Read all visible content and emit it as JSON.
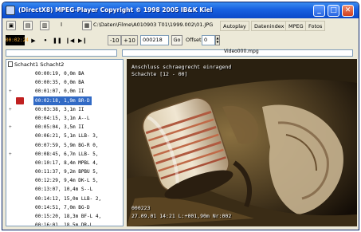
{
  "window": {
    "title": "(DirectX8)  MPEG-Player  Copyright © 1998 2005 IB&K  Kiel"
  },
  "toolbar": {
    "file_path": "C:\\Daten\\Filme\\A010903 T01\\1999.002\\01.JPG",
    "autoplay_label": "Autoplay",
    "dateindex_label": "Datenindex",
    "mpeg_label": "MPEG",
    "fotos_label": "Fotos"
  },
  "transport": {
    "timecode": "00:02:24",
    "back10_label": "-10",
    "fwd10_label": "+10",
    "frame_value": "000218",
    "go_label": "Go",
    "offset_label": "Offset",
    "offset_value": "0"
  },
  "video_file": "Video000.mpg",
  "tree": {
    "header": "Schacht1  Schacht2",
    "rows": [
      {
        "time": "00:00:19",
        "text": "0,0m BA",
        "expand": "",
        "selected": false,
        "marker": false
      },
      {
        "time": "00:00:35",
        "text": "0,0m BA",
        "expand": "",
        "selected": false,
        "marker": false
      },
      {
        "time": "00:01:07",
        "text": "0,0m II",
        "expand": "+",
        "selected": false,
        "marker": false
      },
      {
        "time": "00:02:18",
        "text": "1,9m BR-D",
        "expand": "",
        "selected": true,
        "marker": true
      },
      {
        "time": "00:03:38",
        "text": "3,1m II",
        "expand": "+",
        "selected": false,
        "marker": false
      },
      {
        "time": "00:04:15",
        "text": "3,1m A--L",
        "expand": "",
        "selected": false,
        "marker": false
      },
      {
        "time": "00:05:04",
        "text": "3,5m II",
        "expand": "+",
        "selected": false,
        "marker": false
      },
      {
        "time": "00:06:21",
        "text": "5,1m LLB-  3,",
        "expand": "",
        "selected": false,
        "marker": false
      },
      {
        "time": "00:07:59",
        "text": "5,9m BG-R  0,",
        "expand": "",
        "selected": false,
        "marker": false
      },
      {
        "time": "00:08:45",
        "text": "6,7m LLB-  5,",
        "expand": "+",
        "selected": false,
        "marker": false
      },
      {
        "time": "00:10:17",
        "text": "8,4m MPBL  4,",
        "expand": "",
        "selected": false,
        "marker": false
      },
      {
        "time": "00:11:37",
        "text": "9,2m BPBU  5,",
        "expand": "",
        "selected": false,
        "marker": false
      },
      {
        "time": "00:12:29",
        "text": "9,4m DK-L  5,",
        "expand": "",
        "selected": false,
        "marker": false
      },
      {
        "time": "00:13:07",
        "text": "10,4m S--L",
        "expand": "",
        "selected": false,
        "marker": false
      },
      {
        "time": "00:14:12",
        "text": "15,0m LLB-  2,",
        "expand": "",
        "selected": false,
        "marker": false
      },
      {
        "time": "00:14:51",
        "text": "7,0m BG-D",
        "expand": "",
        "selected": false,
        "marker": false
      },
      {
        "time": "00:15:20",
        "text": "18,3m BF-L  4,",
        "expand": "",
        "selected": false,
        "marker": false
      },
      {
        "time": "00:16:01",
        "text": "18,5m DR-L",
        "expand": "",
        "selected": false,
        "marker": false
      }
    ]
  },
  "overlay": {
    "top_line1": "Anschluss   schraegrecht einragend",
    "top_line2": "Schachte  [12 - 00]",
    "frame_no": "000223",
    "bottom_line": "27.09.01  14:21  L:+001,90m Nr:002"
  },
  "colors": {
    "title_bar": "#1760e0",
    "selection": "#316ac5",
    "timecode_text": "#ffb030"
  }
}
